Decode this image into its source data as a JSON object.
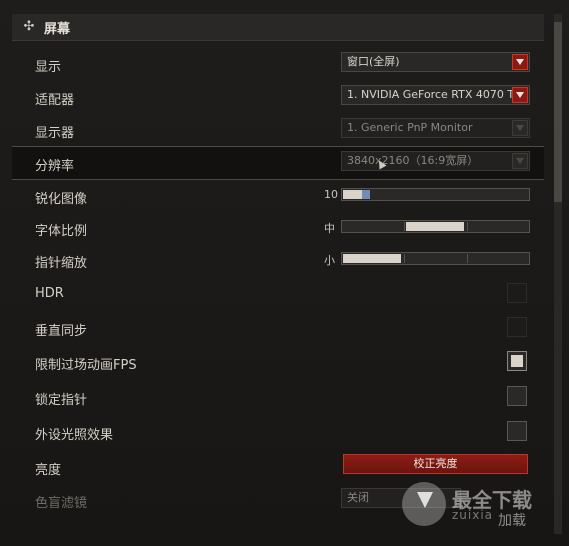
{
  "header": {
    "title": "屏幕",
    "icon": "crosshair-icon"
  },
  "rows": {
    "display": {
      "label": "显示",
      "value": "窗口(全屏)"
    },
    "adapter": {
      "label": "适配器",
      "value": "1. NVIDIA GeForce RTX 4070 T"
    },
    "monitor": {
      "label": "显示器",
      "value": "1. Generic PnP Monitor"
    },
    "resolution": {
      "label": "分辨率",
      "value": "3840x2160（16:9宽屏）"
    },
    "sharpen": {
      "label": "锐化图像",
      "value_text": "10",
      "level": 0.1
    },
    "font_scale": {
      "label": "字体比例",
      "value_text": "中",
      "level": 0.5
    },
    "pointer_scale": {
      "label": "指针缩放",
      "value_text": "小",
      "level": 0.33
    },
    "hdr": {
      "label": "HDR",
      "checked": false
    },
    "vsync": {
      "label": "垂直同步",
      "checked": false
    },
    "limit_fps": {
      "label": "限制过场动画FPS",
      "checked": true
    },
    "lock_pointer": {
      "label": "锁定指针",
      "checked": false
    },
    "peripheral_lighting": {
      "label": "外设光照效果",
      "checked": false
    },
    "brightness": {
      "label": "亮度",
      "button": "校正亮度"
    },
    "colorblind": {
      "label": "色盲滤镜",
      "value": "关闭"
    }
  },
  "colors": {
    "accent_red": "#8b1a14",
    "slider_knob": "#6e8fb3"
  },
  "watermark": {
    "line1": "最全下载",
    "line2": "zuixia",
    "line3": "加载"
  }
}
